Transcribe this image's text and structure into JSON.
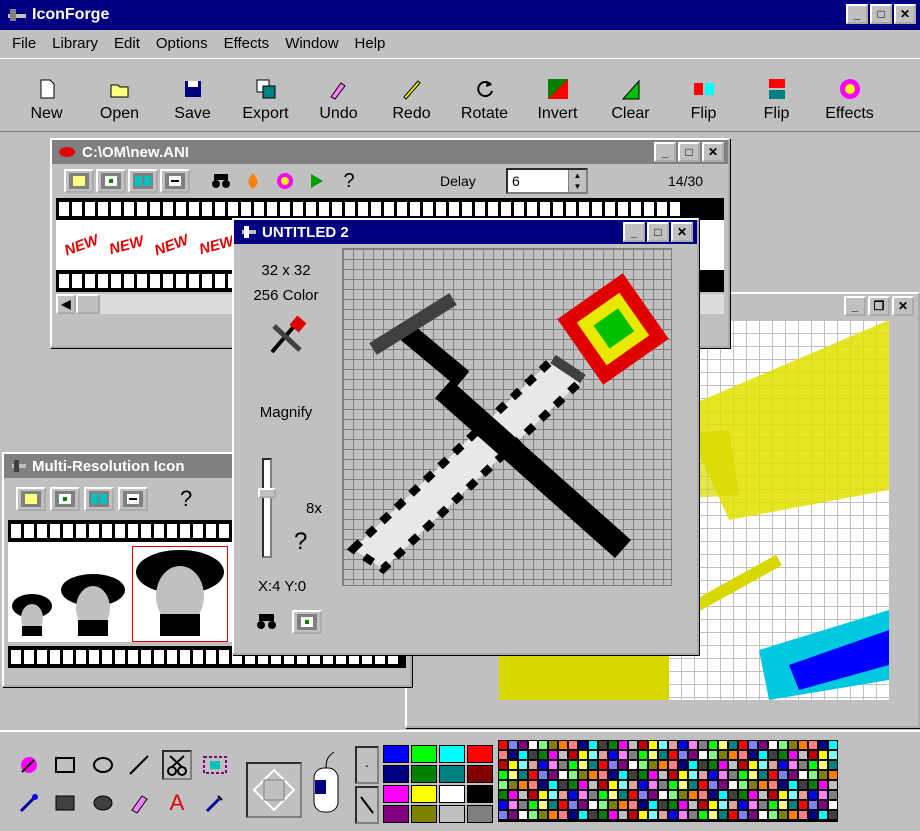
{
  "app": {
    "title": "IconForge"
  },
  "menu": [
    "File",
    "Library",
    "Edit",
    "Options",
    "Effects",
    "Window",
    "Help"
  ],
  "toolbar": [
    {
      "label": "New",
      "icon": "new-icon"
    },
    {
      "label": "Open",
      "icon": "open-icon"
    },
    {
      "label": "Save",
      "icon": "save-icon"
    },
    {
      "label": "Export",
      "icon": "export-icon"
    },
    {
      "label": "Undo",
      "icon": "undo-icon"
    },
    {
      "label": "Redo",
      "icon": "redo-icon"
    },
    {
      "label": "Rotate",
      "icon": "rotate-icon"
    },
    {
      "label": "Invert",
      "icon": "invert-icon"
    },
    {
      "label": "Clear",
      "icon": "clear-icon"
    },
    {
      "label": "Flip",
      "icon": "flip-horizontal-icon"
    },
    {
      "label": "Flip",
      "icon": "flip-vertical-icon"
    },
    {
      "label": "Effects",
      "icon": "effects-icon"
    }
  ],
  "ani_window": {
    "title": "C:\\OM\\new.ANI",
    "delay_label": "Delay",
    "delay_value": "6",
    "frame_counter": "14/30",
    "frame_text": "NEW"
  },
  "editor_window": {
    "title": "UNTITLED 2",
    "size": "32 x 32",
    "colors": "256 Color",
    "magnify_label": "Magnify",
    "magnify_value": "8x",
    "help": "?",
    "coords": "X:4 Y:0"
  },
  "multi_window": {
    "title": "Multi-Resolution Icon",
    "help": "?"
  },
  "colors": {
    "titlebar_active": "#000080",
    "titlebar_inactive": "#808080",
    "face": "#c0c0c0"
  },
  "palette": [
    "#0000ff",
    "#00ff00",
    "#00ffff",
    "#ff0000",
    "#000080",
    "#008000",
    "#008080",
    "#800000",
    "#ff00ff",
    "#ffff00",
    "#ffffff",
    "#000000",
    "#800080",
    "#808000",
    "#c0c0c0",
    "#808080"
  ]
}
